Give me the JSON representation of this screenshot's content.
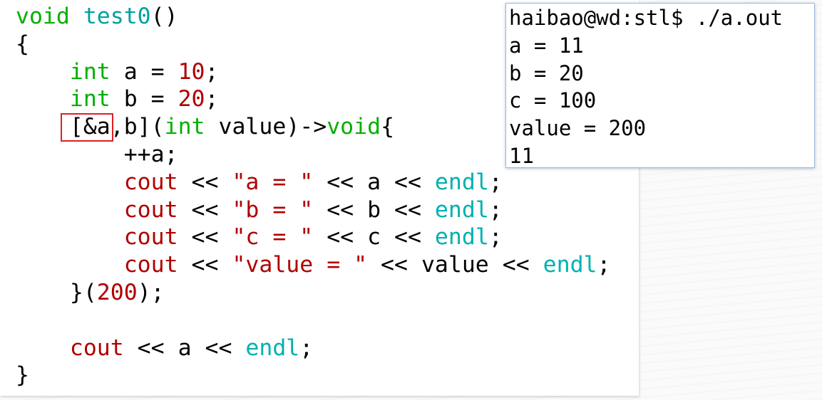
{
  "code": {
    "lines": [
      [
        {
          "t": "void",
          "c": "keyword"
        },
        {
          "t": " ",
          "c": "plain"
        },
        {
          "t": "test0",
          "c": "func"
        },
        {
          "t": "()",
          "c": "plain"
        }
      ],
      [
        {
          "t": "{",
          "c": "plain"
        }
      ],
      [
        {
          "t": "    ",
          "c": "plain"
        },
        {
          "t": "int",
          "c": "keyword"
        },
        {
          "t": " a = ",
          "c": "plain"
        },
        {
          "t": "10",
          "c": "number"
        },
        {
          "t": ";",
          "c": "plain"
        }
      ],
      [
        {
          "t": "    ",
          "c": "plain"
        },
        {
          "t": "int",
          "c": "keyword"
        },
        {
          "t": " b = ",
          "c": "plain"
        },
        {
          "t": "20",
          "c": "number"
        },
        {
          "t": ";",
          "c": "plain"
        }
      ],
      [
        {
          "t": "    [&a,b](",
          "c": "plain"
        },
        {
          "t": "int",
          "c": "keyword"
        },
        {
          "t": " value)->",
          "c": "plain"
        },
        {
          "t": "void",
          "c": "keyword"
        },
        {
          "t": "{",
          "c": "plain"
        }
      ],
      [
        {
          "t": "        ++a;",
          "c": "plain"
        }
      ],
      [
        {
          "t": "        ",
          "c": "plain"
        },
        {
          "t": "cout",
          "c": "stream"
        },
        {
          "t": " << ",
          "c": "plain"
        },
        {
          "t": "\"a = \"",
          "c": "string"
        },
        {
          "t": " << a << ",
          "c": "plain"
        },
        {
          "t": "endl",
          "c": "endl"
        },
        {
          "t": ";",
          "c": "plain"
        }
      ],
      [
        {
          "t": "        ",
          "c": "plain"
        },
        {
          "t": "cout",
          "c": "stream"
        },
        {
          "t": " << ",
          "c": "plain"
        },
        {
          "t": "\"b = \"",
          "c": "string"
        },
        {
          "t": " << b << ",
          "c": "plain"
        },
        {
          "t": "endl",
          "c": "endl"
        },
        {
          "t": ";",
          "c": "plain"
        }
      ],
      [
        {
          "t": "        ",
          "c": "plain"
        },
        {
          "t": "cout",
          "c": "stream"
        },
        {
          "t": " << ",
          "c": "plain"
        },
        {
          "t": "\"c = \"",
          "c": "string"
        },
        {
          "t": " << c << ",
          "c": "plain"
        },
        {
          "t": "endl",
          "c": "endl"
        },
        {
          "t": ";",
          "c": "plain"
        }
      ],
      [
        {
          "t": "        ",
          "c": "plain"
        },
        {
          "t": "cout",
          "c": "stream"
        },
        {
          "t": " << ",
          "c": "plain"
        },
        {
          "t": "\"value = \"",
          "c": "string"
        },
        {
          "t": " << value << ",
          "c": "plain"
        },
        {
          "t": "endl",
          "c": "endl"
        },
        {
          "t": ";",
          "c": "plain"
        }
      ],
      [
        {
          "t": "    }(",
          "c": "plain"
        },
        {
          "t": "200",
          "c": "number"
        },
        {
          "t": ");",
          "c": "plain"
        }
      ],
      [
        {
          "t": "",
          "c": "plain"
        }
      ],
      [
        {
          "t": "    ",
          "c": "plain"
        },
        {
          "t": "cout",
          "c": "stream"
        },
        {
          "t": " << a << ",
          "c": "plain"
        },
        {
          "t": "endl",
          "c": "endl"
        },
        {
          "t": ";",
          "c": "plain"
        }
      ],
      [
        {
          "t": "}",
          "c": "plain"
        }
      ]
    ]
  },
  "terminal": {
    "lines": [
      "haibao@wd:stl$ ./a.out",
      "a = 11",
      "b = 20",
      "c = 100",
      "value = 200",
      "11"
    ]
  },
  "colors": {
    "keyword": "#00b000",
    "func": "#00a0a0",
    "number": "#b00000",
    "string": "#b00000",
    "stream": "#b00000",
    "endl": "#00b0b0",
    "highlight_box": "#e02020",
    "terminal_border": "#9db9d9"
  }
}
